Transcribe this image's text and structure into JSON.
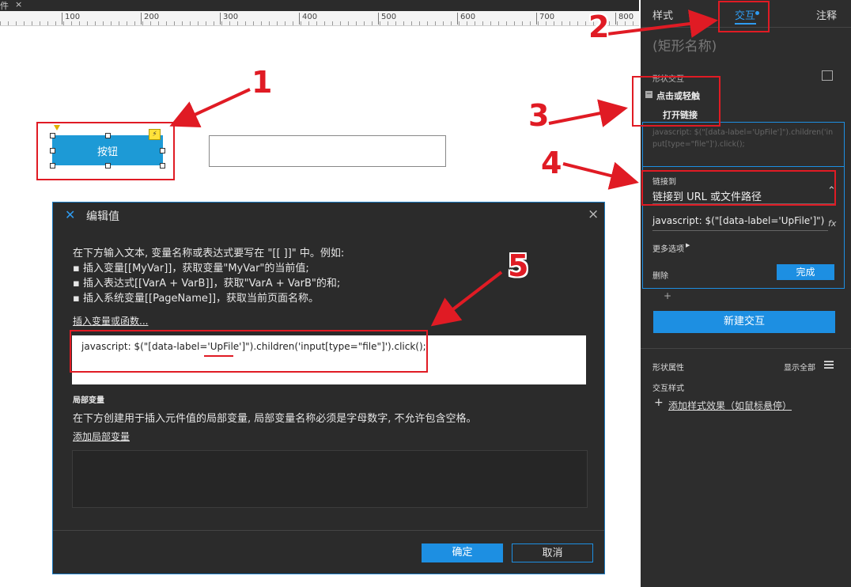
{
  "toolbar": {
    "tab_glyph": "件",
    "close_glyph": "×"
  },
  "ruler": {
    "labels": [
      "100",
      "200",
      "300",
      "400",
      "500",
      "600",
      "700",
      "800"
    ]
  },
  "canvas": {
    "button_label": "按钮",
    "lightning_icon": "⚡"
  },
  "annotations": {
    "n1": "1",
    "n2": "2",
    "n3": "3",
    "n4": "4",
    "n5": "5",
    "color": "#e01b24"
  },
  "panel": {
    "tabs": {
      "style": "样式",
      "interaction": "交互",
      "note": "注释"
    },
    "shape_name": "(矩形名称)",
    "shape_interaction": "形状交互",
    "event": "点击或轻触",
    "action": "打开链接",
    "preview": "javascript: $(\"[data-label='UpFile']\").children('input[type=\"file\"]').click();",
    "link_to_label": "链接到",
    "link_to_value": "链接到 URL 或文件路径",
    "url_value": "javascript: $(\"[data-label='UpFile']\")",
    "fx": "fx",
    "more_options": "更多选项",
    "delete": "删除",
    "done": "完成",
    "plus": "+",
    "new_interaction": "新建交互",
    "shape_props": "形状属性",
    "show_all": "显示全部",
    "interaction_style": "交互样式",
    "add_style_effect": "添加样式效果（如鼠标悬停）",
    "accent": "#1d8fe2"
  },
  "dialog": {
    "title": "编辑值",
    "instructions": [
      "在下方输入文本, 变量名称或表达式要写在 \"[[ ]]\" 中。例如:",
      "▪ 插入变量[[MyVar]]，获取变量\"MyVar\"的当前值;",
      "▪ 插入表达式[[VarA + VarB]]，获取\"VarA + VarB\"的和;",
      "▪ 插入系统变量[[PageName]]，获取当前页面名称。"
    ],
    "insert_link": "插入变量或函数...",
    "value_text": "javascript: $(\"[data-label='UpFile']\").children('input[type=\"file\"]').click();",
    "local_vars_heading": "局部变量",
    "local_vars_desc": "在下方创建用于插入元件值的局部变量, 局部变量名称必须是字母数字, 不允许包含空格。",
    "add_local_var": "添加局部变量",
    "ok": "确定",
    "cancel": "取消"
  }
}
